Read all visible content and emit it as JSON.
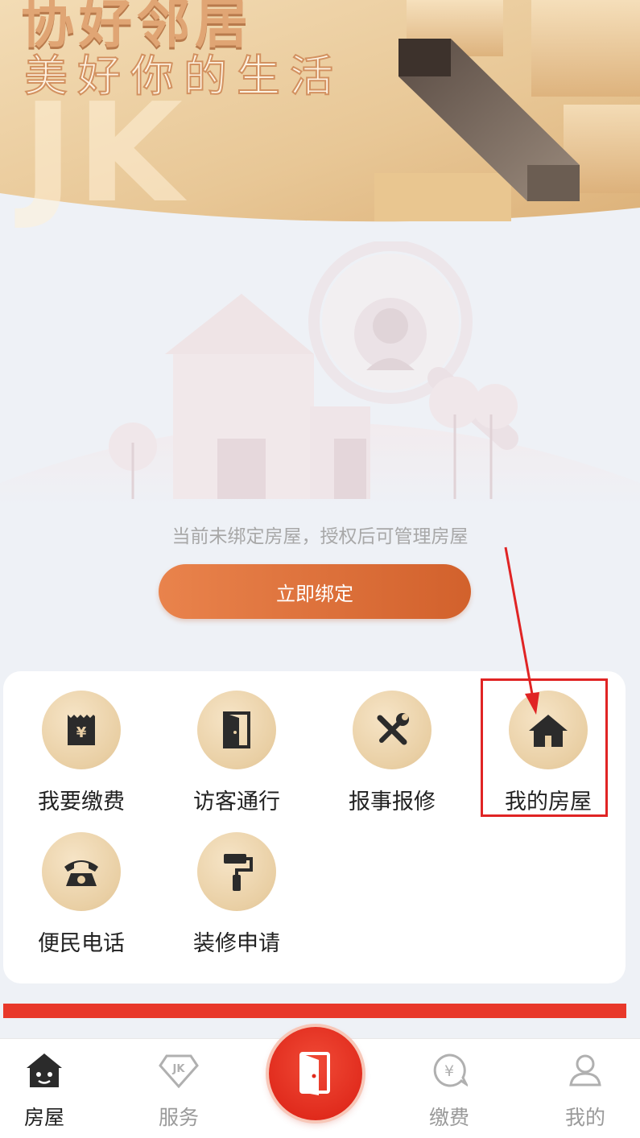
{
  "banner": {
    "headline": "协好邻居",
    "subtitle": "美好你的生活",
    "watermark": "JK"
  },
  "empty_state": {
    "message": "当前未绑定房屋，授权后可管理房屋",
    "bind_button_label": "立即绑定"
  },
  "services": [
    {
      "label": "我要缴费",
      "icon": "payment-receipt-icon"
    },
    {
      "label": "访客通行",
      "icon": "door-icon"
    },
    {
      "label": "报事报修",
      "icon": "tools-icon"
    },
    {
      "label": "我的房屋",
      "icon": "house-icon"
    },
    {
      "label": "便民电话",
      "icon": "telephone-icon"
    },
    {
      "label": "装修申请",
      "icon": "paint-roller-icon"
    }
  ],
  "bottom_nav": {
    "items": [
      {
        "label": "房屋",
        "icon": "house-face-icon",
        "active": true
      },
      {
        "label": "服务",
        "icon": "jk-diamond-icon",
        "active": false
      },
      {
        "label": "缴费",
        "icon": "yen-chat-icon",
        "active": false
      },
      {
        "label": "我的",
        "icon": "user-icon",
        "active": false
      }
    ],
    "center_button_icon": "door-open-icon"
  },
  "colors": {
    "accent_orange": "#d2612c",
    "icon_gold": "#e9cfa4",
    "highlight_red": "#e02424",
    "nav_center_red": "#e02a1c"
  }
}
